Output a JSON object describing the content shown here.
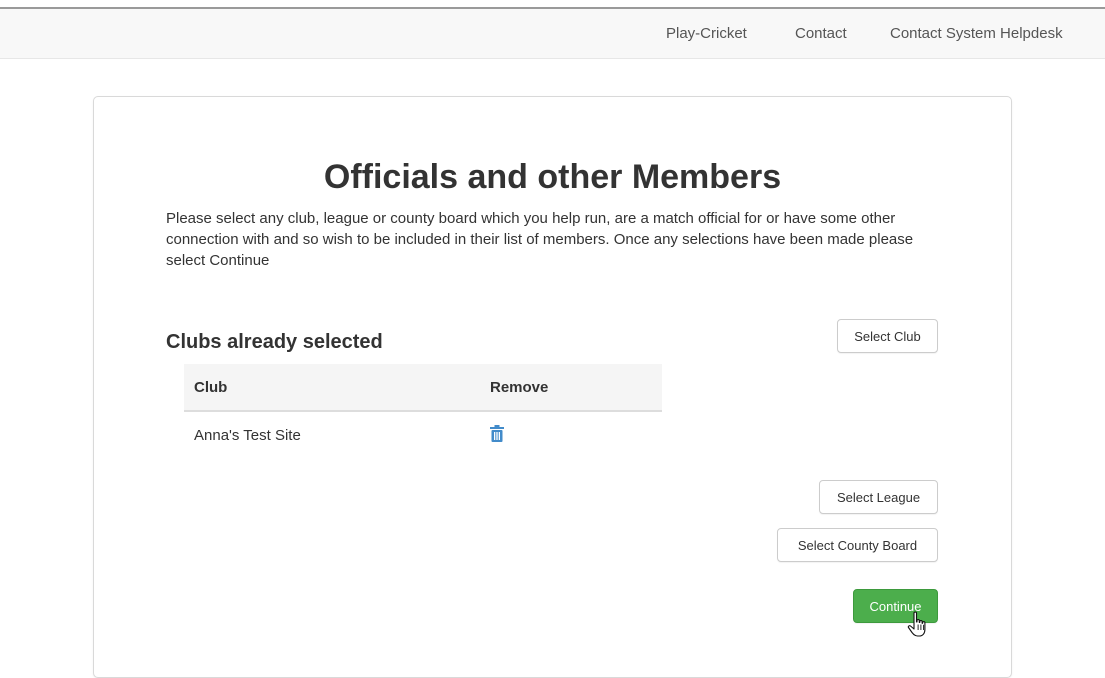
{
  "nav": {
    "links": [
      "Play-Cricket",
      "Contact",
      "Contact System Helpdesk"
    ]
  },
  "page": {
    "title": "Officials and other Members",
    "intro": "Please select any club, league or county board which you help run, are a match official for or have some other connection with and so wish to be included in their list of members. Once any selections have been made please select Continue"
  },
  "clubs": {
    "heading": "Clubs already selected",
    "columns": [
      "Club",
      "Remove"
    ],
    "rows": [
      {
        "club": "Anna's Test Site",
        "remove_icon": "trash-icon"
      }
    ]
  },
  "buttons": {
    "select_club": "Select Club",
    "select_league": "Select League",
    "select_county_board": "Select County Board",
    "continue": "Continue"
  },
  "colors": {
    "navbar_bg": "#f8f8f8",
    "continue_green": "#4cae4c",
    "trash_blue": "#428bca"
  },
  "icons": {
    "cursor": "hand-pointer-icon"
  }
}
